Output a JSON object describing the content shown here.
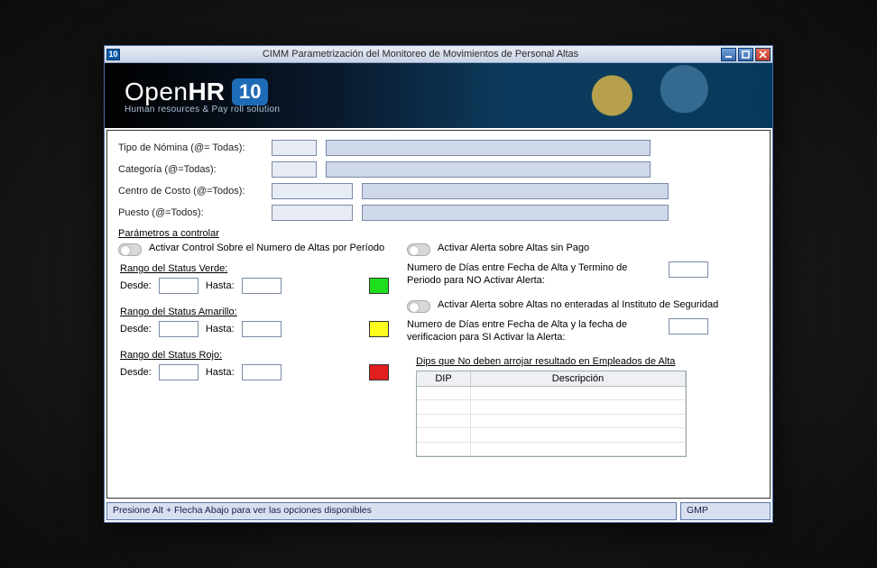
{
  "titlebar": {
    "icon_text": "10",
    "title": "CIMM Parametrización del Monitoreo de Movimientos de Personal Altas"
  },
  "brand": {
    "name_light": "Open",
    "name_bold": "HR",
    "version_badge": "10",
    "subtitle": "Human resources & Pay roll solution"
  },
  "filters": {
    "tipo_nomina": {
      "label": "Tipo de Nómina (@= Todas):",
      "code": "",
      "desc": "",
      "desc_width": 360
    },
    "categoria": {
      "label": "Categoría (@=Todas):",
      "code": "",
      "desc": "",
      "desc_width": 360
    },
    "centro": {
      "label": "Centro de Costo (@=Todos):",
      "code": "",
      "desc": "",
      "desc_width": 340
    },
    "puesto": {
      "label": "Puesto (@=Todos):",
      "code": "",
      "desc": "",
      "desc_width": 340
    }
  },
  "params_title": "Parámetros a controlar",
  "left": {
    "toggle1": "Activar Control Sobre el Numero de Altas por Período",
    "green": {
      "title": "Rango del Status Verde:",
      "desde_lbl": "Desde:",
      "hasta_lbl": "Hasta:",
      "desde": "",
      "hasta": ""
    },
    "yellow": {
      "title": "Rango del Status Amarillo:",
      "desde_lbl": "Desde:",
      "hasta_lbl": "Hasta:",
      "desde": "",
      "hasta": ""
    },
    "red": {
      "title": "Rango del Status Rojo:",
      "desde_lbl": "Desde:",
      "hasta_lbl": "Hasta:",
      "desde": "",
      "hasta": ""
    }
  },
  "right": {
    "toggle2": "Activar Alerta sobre Altas sin Pago",
    "dias_no_activar_lbl": "Numero de Días entre Fecha de Alta y Termino de Periodo para NO Activar Alerta:",
    "dias_no_activar": "",
    "toggle3": "Activar Alerta sobre Altas no enteradas al Instituto de Seguridad",
    "dias_si_activar_lbl": "Numero de Días entre Fecha de Alta y la fecha de verificacion para SI Activar la Alerta:",
    "dias_si_activar": "",
    "exc_title": "Dips que No deben arrojar resultado en Empleados de Alta",
    "grid_headers": {
      "dip": "DIP",
      "desc": "Descripción"
    }
  },
  "statusbar": {
    "hint": "Presione Alt + Flecha Abajo para ver las opciones disponibles",
    "right": "GMP"
  }
}
